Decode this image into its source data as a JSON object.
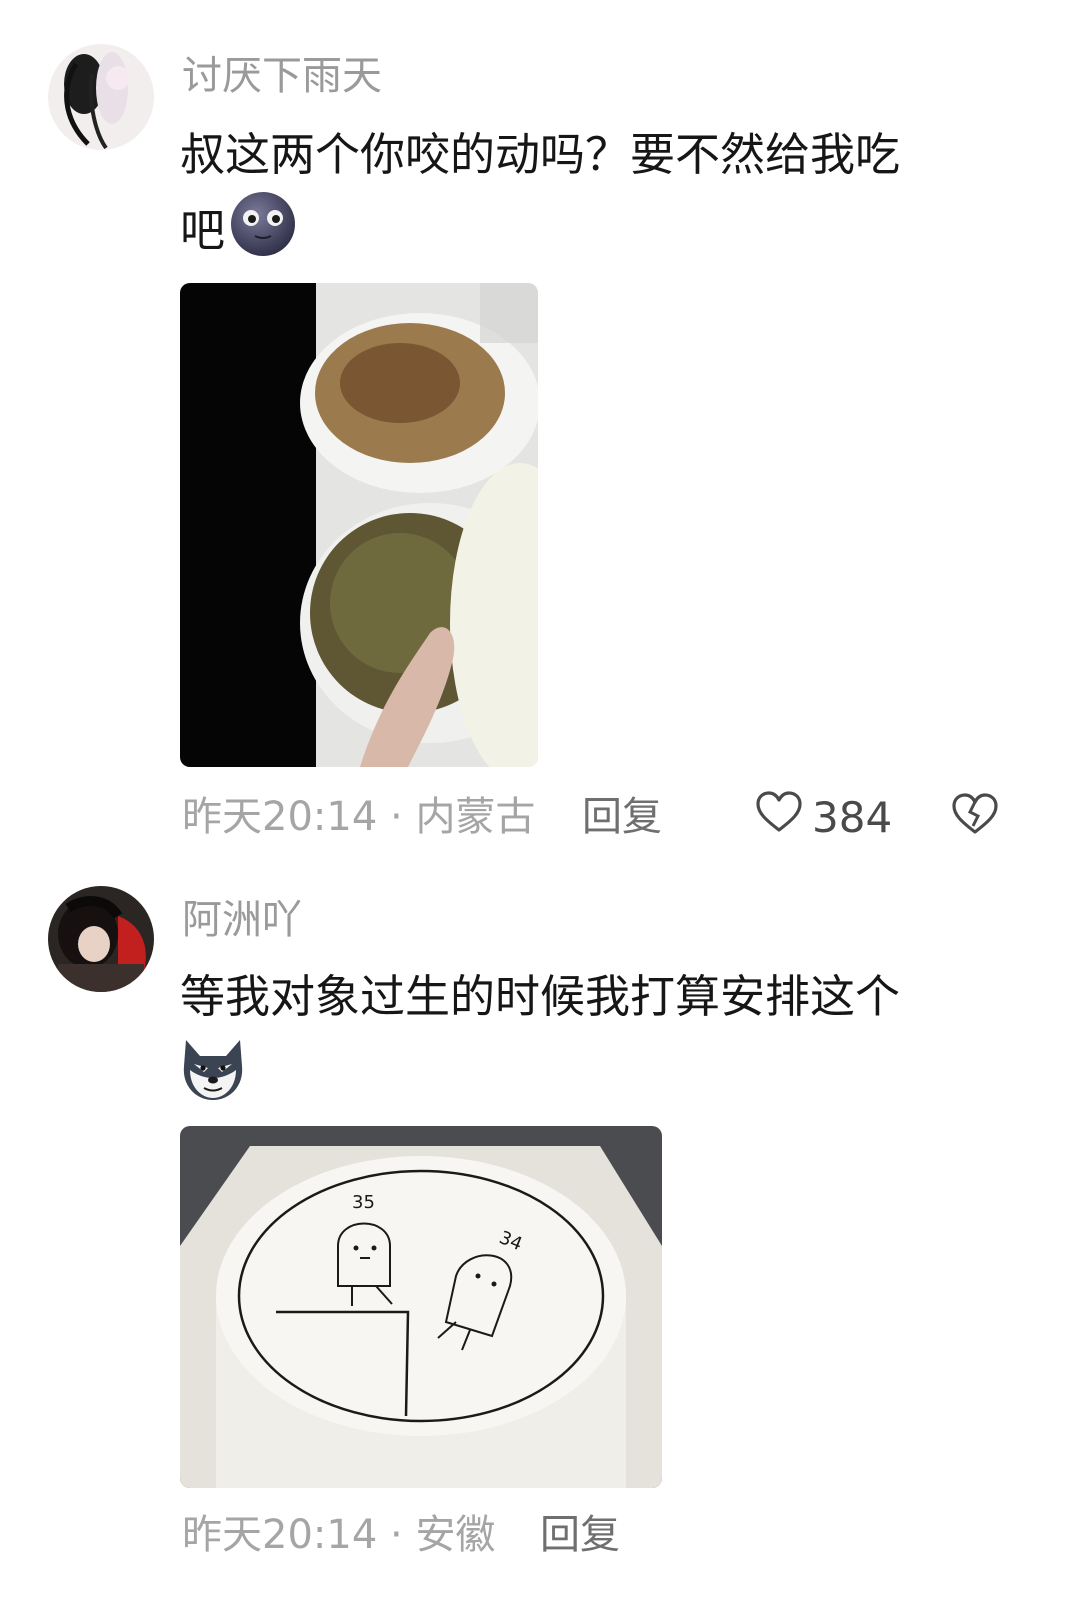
{
  "comments": [
    {
      "username": "讨厌下雨天",
      "content_line1": "叔这两个你咬的动吗？要不然给我吃",
      "content_line2": "吧",
      "emoji_icon": "moon-face-emoji",
      "time": "昨天20:14",
      "separator": "·",
      "location": "内蒙古",
      "reply_label": "回复",
      "likes": "384"
    },
    {
      "username": "阿洲吖",
      "content_line1": "等我对象过生的时候我打算安排这个",
      "emoji_icon": "wolf-face-emoji",
      "cake_label_35": "35",
      "cake_label_34": "34",
      "time": "昨天20:14",
      "separator": "·",
      "location": "安徽",
      "reply_label": "回复"
    }
  ],
  "colors": {
    "username": "#9a9a9a",
    "meta": "#a5a5a5",
    "reply": "#6f6f6f",
    "content": "#161616"
  }
}
